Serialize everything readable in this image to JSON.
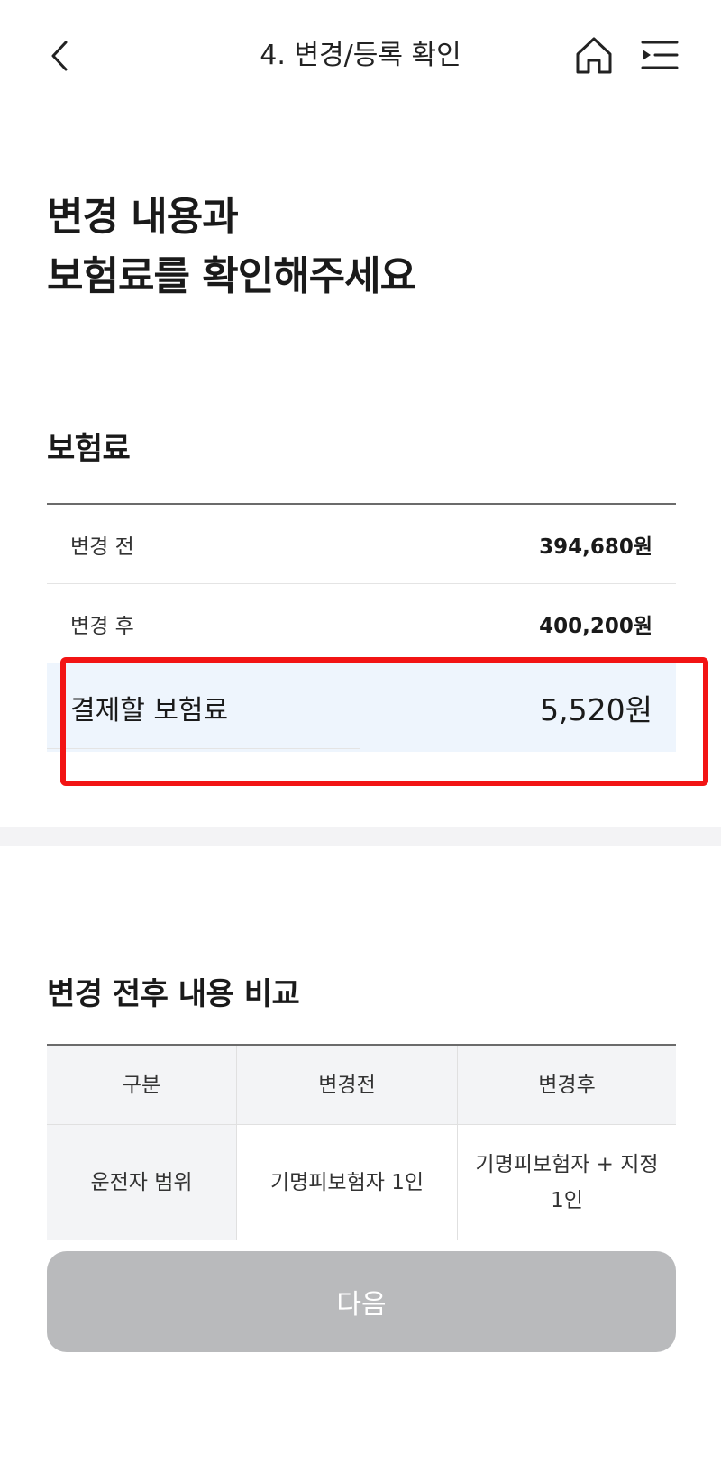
{
  "header": {
    "title": "4. 변경/등록 확인",
    "back_icon": "chevron-left-icon",
    "home_icon": "home-icon",
    "menu_icon": "menu-icon"
  },
  "hero": {
    "line1": "변경 내용과",
    "line2": "보험료를 확인해주세요"
  },
  "premium": {
    "title": "보험료",
    "rows": [
      {
        "label": "변경 전",
        "value": "394,680원"
      },
      {
        "label": "변경 후",
        "value": "400,200원"
      }
    ],
    "payment": {
      "label": "결제할 보험료",
      "value": "5,520원"
    }
  },
  "compare": {
    "title": "변경 전후 내용 비교",
    "headers": [
      "구분",
      "변경전",
      "변경후"
    ],
    "rows": [
      {
        "category": "운전자 범위",
        "before": "기명피보험자 1인",
        "after": "기명피보험자 + 지정 1인"
      }
    ]
  },
  "next_button": {
    "label": "다음"
  },
  "colors": {
    "highlight_border": "#f21414",
    "payment_row_bg": "#eef5fd",
    "button_disabled": "#b9babc"
  }
}
